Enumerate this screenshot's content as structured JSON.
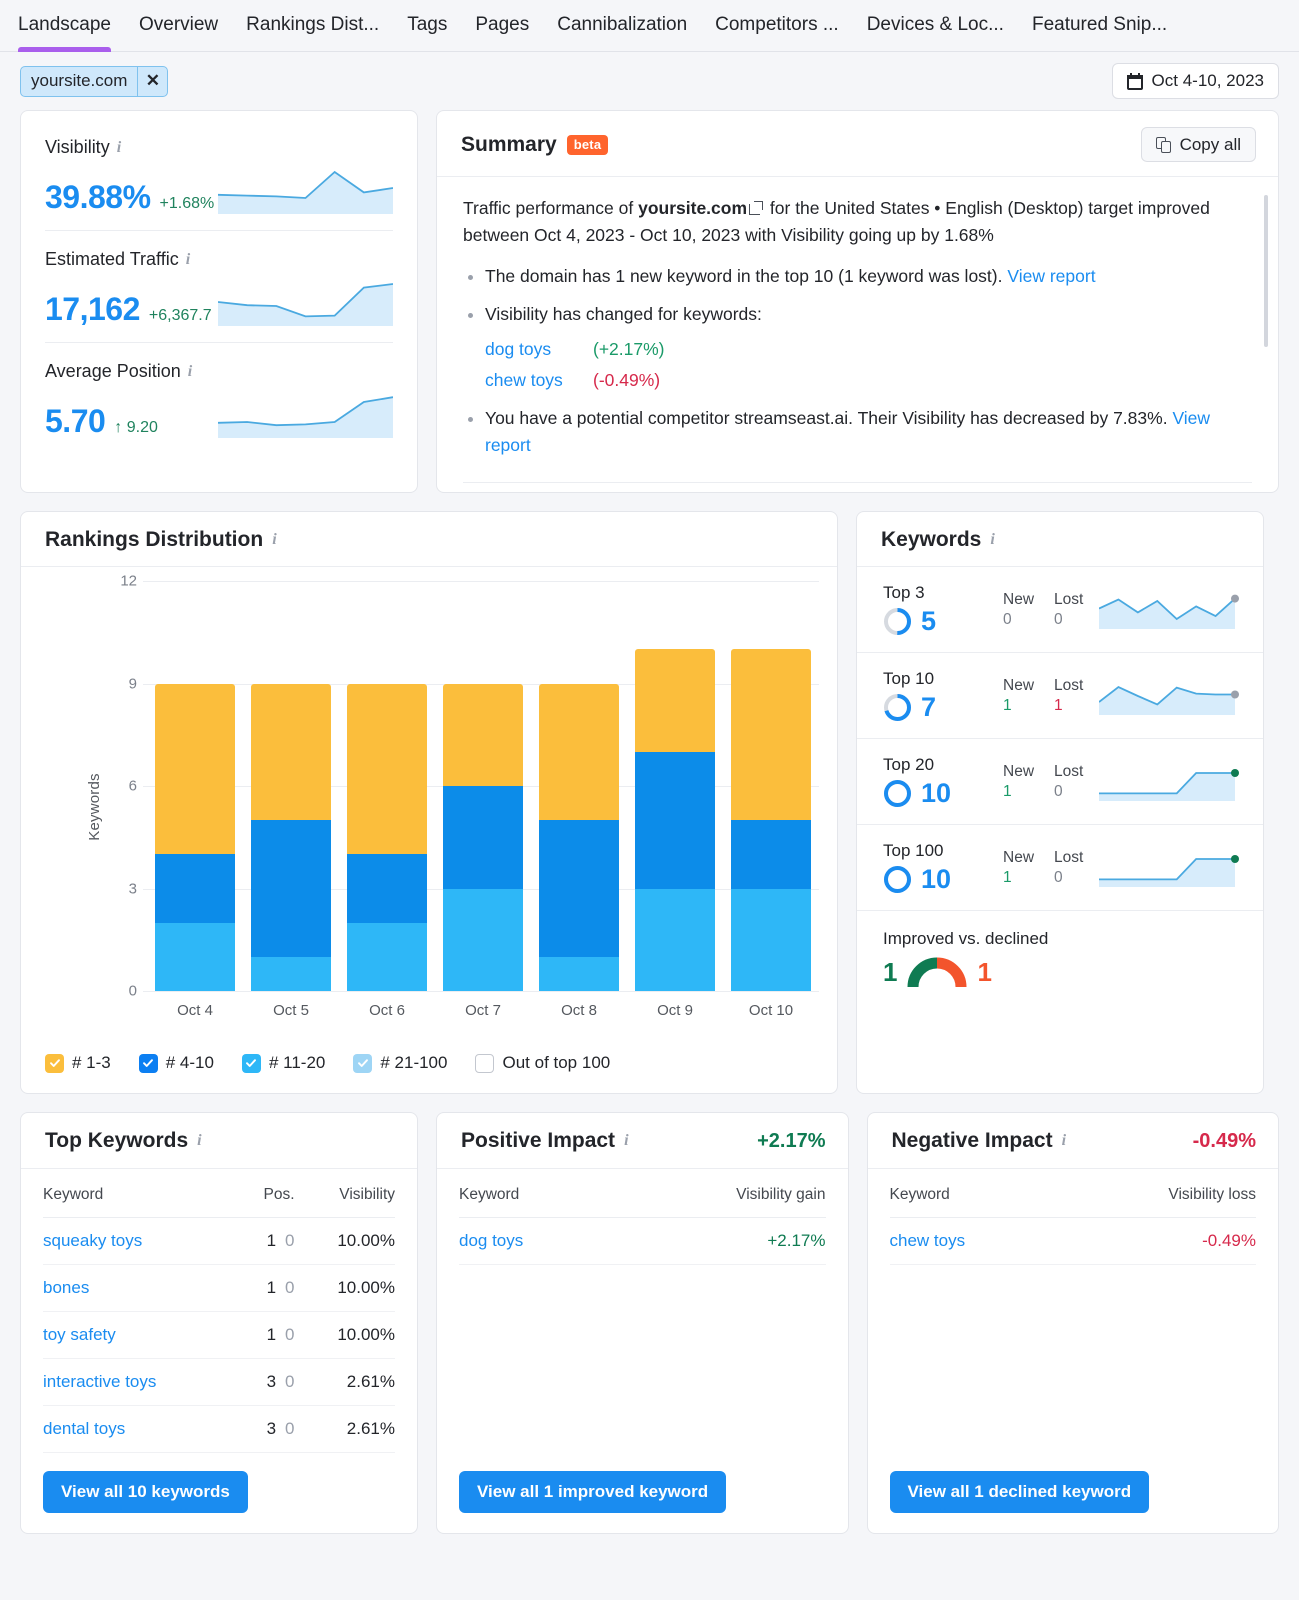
{
  "tabs": [
    {
      "label": "Landscape",
      "active": true
    },
    {
      "label": "Overview",
      "active": false
    },
    {
      "label": "Rankings Dist...",
      "active": false
    },
    {
      "label": "Tags",
      "active": false
    },
    {
      "label": "Pages",
      "active": false
    },
    {
      "label": "Cannibalization",
      "active": false
    },
    {
      "label": "Competitors ...",
      "active": false
    },
    {
      "label": "Devices & Loc...",
      "active": false
    },
    {
      "label": "Featured Snip...",
      "active": false
    }
  ],
  "filter": {
    "site_chip": "yoursite.com",
    "remove_label": "✕",
    "date_range": "Oct 4-10, 2023"
  },
  "metrics": [
    {
      "label": "Visibility",
      "value": "39.88%",
      "delta": "+1.68%",
      "spark": "visibility-sparkline"
    },
    {
      "label": "Estimated Traffic",
      "value": "17,162",
      "delta": "+6,367.7",
      "spark": "traffic-sparkline"
    },
    {
      "label": "Average Position",
      "value": "5.70",
      "delta": "↑ 9.20",
      "spark": "position-sparkline"
    }
  ],
  "summary": {
    "title": "Summary",
    "badge": "beta",
    "copy_label": "Copy all",
    "lead_1": "Traffic performance of",
    "lead_site": "yoursite.com",
    "lead_2": "for the United States • English (Desktop) target improved between Oct 4, 2023 - Oct 10, 2023 with Visibility going up by 1.68%",
    "bullet_1": "The domain has 1 new keyword in the top 10 (1 keyword was lost).",
    "bullet_1_link": "View report",
    "bullet_2": "Visibility has changed for keywords:",
    "kw_changes": [
      {
        "keyword": "dog toys",
        "change": "(+2.17%)",
        "dir": "up"
      },
      {
        "keyword": "chew toys",
        "change": "(-0.49%)",
        "dir": "down"
      }
    ],
    "bullet_3": "You have a potential competitor streamseast.ai. Their Visibility has decreased by 7.83%.",
    "bullet_3_link": "View report"
  },
  "chart_data": {
    "type": "bar",
    "title": "Rankings Distribution",
    "xlabel": "",
    "ylabel": "Keywords",
    "ylim": [
      0,
      12
    ],
    "yticks": [
      0,
      3,
      6,
      9,
      12
    ],
    "grid": true,
    "stacked": true,
    "legend_position": "bottom",
    "categories": [
      "Oct 4",
      "Oct 5",
      "Oct 6",
      "Oct 7",
      "Oct 8",
      "Oct 9",
      "Oct 10"
    ],
    "series": [
      {
        "name": "# 21-100",
        "color": "#2eb7f7",
        "values": [
          2,
          1,
          2,
          3,
          1,
          3,
          3
        ]
      },
      {
        "name": "# 11-20",
        "color": "#0c8ce9",
        "values": [
          2,
          4,
          2,
          3,
          4,
          4,
          2
        ]
      },
      {
        "name": "# 4-10",
        "color": "#0c8ce9",
        "values": [
          0,
          0,
          0,
          0,
          0,
          0,
          0
        ]
      },
      {
        "name": "# 1-3",
        "color": "#fbbe3c",
        "values": [
          5,
          4,
          5,
          3,
          4,
          3,
          5
        ]
      }
    ],
    "totals": [
      9,
      9,
      9,
      9,
      9,
      10,
      10
    ],
    "legend": [
      {
        "label": "# 1-3",
        "color": "#fbbe3c",
        "checked": true
      },
      {
        "label": "# 4-10",
        "color": "#0c7ff2",
        "checked": true
      },
      {
        "label": "# 11-20",
        "color": "#2eb7f7",
        "checked": true
      },
      {
        "label": "# 21-100",
        "color": "#9ed5f5",
        "checked": true
      },
      {
        "label": "Out of top 100",
        "color": "#ffffff",
        "checked": false
      }
    ]
  },
  "keywords_card": {
    "title": "Keywords",
    "rows": [
      {
        "title": "Top 3",
        "count": "5",
        "ring_pct": 50,
        "new_label": "New",
        "new": "0",
        "lost_label": "Lost",
        "lost": "0",
        "new_state": "neutral",
        "lost_state": "neutral",
        "dot": "#9aa0ab"
      },
      {
        "title": "Top 10",
        "count": "7",
        "ring_pct": 70,
        "new_label": "New",
        "new": "1",
        "lost_label": "Lost",
        "lost": "1",
        "new_state": "up",
        "lost_state": "down",
        "dot": "#9aa0ab"
      },
      {
        "title": "Top 20",
        "count": "10",
        "ring_pct": 100,
        "new_label": "New",
        "new": "1",
        "lost_label": "Lost",
        "lost": "0",
        "new_state": "up",
        "lost_state": "neutral",
        "dot": "#0f7b52"
      },
      {
        "title": "Top 100",
        "count": "10",
        "ring_pct": 100,
        "new_label": "New",
        "new": "1",
        "lost_label": "Lost",
        "lost": "0",
        "new_state": "up",
        "lost_state": "neutral",
        "dot": "#0f7b52"
      }
    ],
    "improved_label": "Improved vs. declined",
    "improved": "1",
    "declined": "1"
  },
  "top_keywords": {
    "title": "Top Keywords",
    "columns": [
      "Keyword",
      "Pos.",
      "Visibility"
    ],
    "rows": [
      {
        "keyword": "squeaky toys",
        "pos": "1",
        "pos_prev": "0",
        "visibility": "10.00%"
      },
      {
        "keyword": "bones",
        "pos": "1",
        "pos_prev": "0",
        "visibility": "10.00%"
      },
      {
        "keyword": "toy safety",
        "pos": "1",
        "pos_prev": "0",
        "visibility": "10.00%"
      },
      {
        "keyword": "interactive toys",
        "pos": "3",
        "pos_prev": "0",
        "visibility": "2.61%"
      },
      {
        "keyword": "dental toys",
        "pos": "3",
        "pos_prev": "0",
        "visibility": "2.61%"
      }
    ],
    "button": "View all 10 keywords"
  },
  "positive_impact": {
    "title": "Positive Impact",
    "headline": "+2.17%",
    "columns": [
      "Keyword",
      "Visibility gain"
    ],
    "rows": [
      {
        "keyword": "dog toys",
        "value": "+2.17%"
      }
    ],
    "button": "View all 1 improved keyword"
  },
  "negative_impact": {
    "title": "Negative Impact",
    "headline": "-0.49%",
    "columns": [
      "Keyword",
      "Visibility loss"
    ],
    "rows": [
      {
        "keyword": "chew toys",
        "value": "-0.49%"
      }
    ],
    "button": "View all 1 declined keyword"
  },
  "colors": {
    "accent_blue": "#1a8cf0",
    "green": "#0f7b52",
    "red": "#d6294b",
    "purple_tab": "#a95eec",
    "yellow": "#fbbe3c"
  }
}
